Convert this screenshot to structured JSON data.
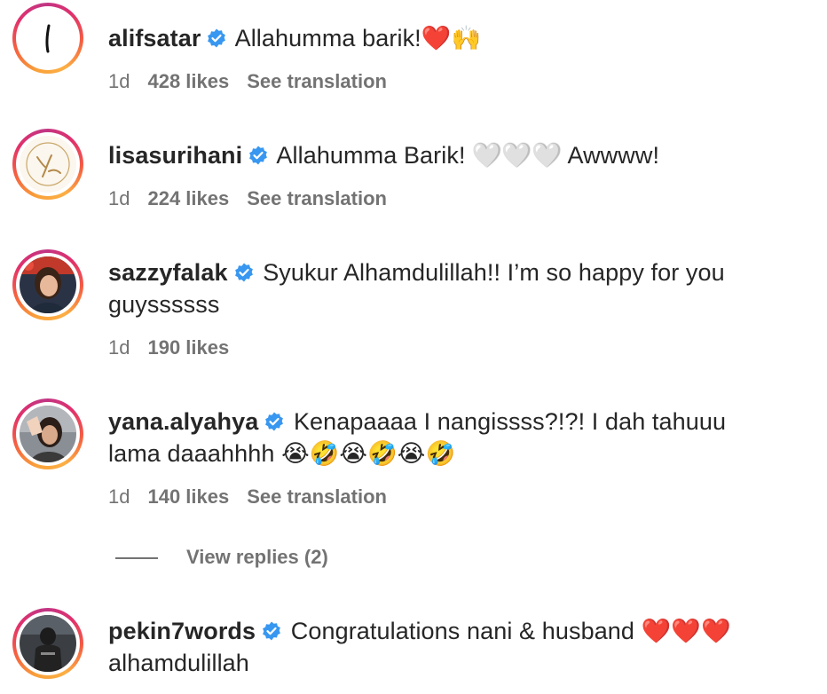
{
  "comments": [
    {
      "username": "alifsatar",
      "text": "Allahumma barik!",
      "emoji": "❤️🙌",
      "time": "1d",
      "likes": "428 likes",
      "see_translation": "See translation"
    },
    {
      "username": "lisasurihani",
      "text": "Allahumma Barik!",
      "emoji": "🤍🤍🤍",
      "text2": "Awwww!",
      "time": "1d",
      "likes": "224 likes",
      "see_translation": "See translation"
    },
    {
      "username": "sazzyfalak",
      "text": "Syukur Alhamdulillah!! I’m so happy for you",
      "text_line2": "guyssssss",
      "time": "1d",
      "likes": "190 likes"
    },
    {
      "username": "yana.alyahya",
      "text": "Kenapaaaa I nangissss?!?! I dah tahuuu",
      "text_line2": "lama daaahhhh",
      "emoji": "😭🤣😭🤣😭🤣",
      "time": "1d",
      "likes": "140 likes",
      "see_translation": "See translation",
      "view_replies": "View replies (2)"
    },
    {
      "username": "pekin7words",
      "text": "Congratulations nani & husband",
      "emoji": "❤️❤️❤️",
      "text_line2": "alhamdulillah"
    }
  ],
  "colors": {
    "verified": "#3897f0",
    "secondary_text": "#737373",
    "primary_text": "#262626"
  },
  "icons": {
    "verified": "verified-badge-icon"
  }
}
